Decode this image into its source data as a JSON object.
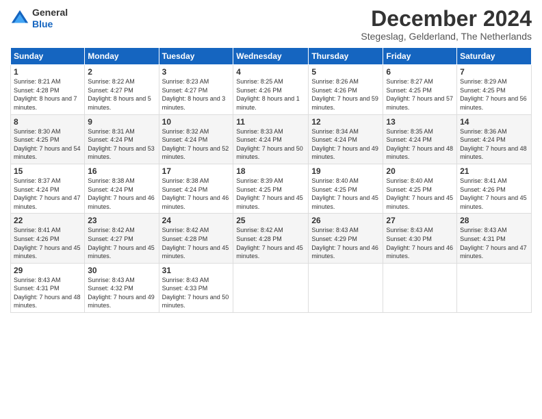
{
  "logo": {
    "general": "General",
    "blue": "Blue"
  },
  "header": {
    "month": "December 2024",
    "location": "Stegeslag, Gelderland, The Netherlands"
  },
  "weekdays": [
    "Sunday",
    "Monday",
    "Tuesday",
    "Wednesday",
    "Thursday",
    "Friday",
    "Saturday"
  ],
  "weeks": [
    [
      {
        "day": "1",
        "sunrise": "8:21 AM",
        "sunset": "4:28 PM",
        "daylight": "8 hours and 7 minutes."
      },
      {
        "day": "2",
        "sunrise": "8:22 AM",
        "sunset": "4:27 PM",
        "daylight": "8 hours and 5 minutes."
      },
      {
        "day": "3",
        "sunrise": "8:23 AM",
        "sunset": "4:27 PM",
        "daylight": "8 hours and 3 minutes."
      },
      {
        "day": "4",
        "sunrise": "8:25 AM",
        "sunset": "4:26 PM",
        "daylight": "8 hours and 1 minute."
      },
      {
        "day": "5",
        "sunrise": "8:26 AM",
        "sunset": "4:26 PM",
        "daylight": "7 hours and 59 minutes."
      },
      {
        "day": "6",
        "sunrise": "8:27 AM",
        "sunset": "4:25 PM",
        "daylight": "7 hours and 57 minutes."
      },
      {
        "day": "7",
        "sunrise": "8:29 AM",
        "sunset": "4:25 PM",
        "daylight": "7 hours and 56 minutes."
      }
    ],
    [
      {
        "day": "8",
        "sunrise": "8:30 AM",
        "sunset": "4:25 PM",
        "daylight": "7 hours and 54 minutes."
      },
      {
        "day": "9",
        "sunrise": "8:31 AM",
        "sunset": "4:24 PM",
        "daylight": "7 hours and 53 minutes."
      },
      {
        "day": "10",
        "sunrise": "8:32 AM",
        "sunset": "4:24 PM",
        "daylight": "7 hours and 52 minutes."
      },
      {
        "day": "11",
        "sunrise": "8:33 AM",
        "sunset": "4:24 PM",
        "daylight": "7 hours and 50 minutes."
      },
      {
        "day": "12",
        "sunrise": "8:34 AM",
        "sunset": "4:24 PM",
        "daylight": "7 hours and 49 minutes."
      },
      {
        "day": "13",
        "sunrise": "8:35 AM",
        "sunset": "4:24 PM",
        "daylight": "7 hours and 48 minutes."
      },
      {
        "day": "14",
        "sunrise": "8:36 AM",
        "sunset": "4:24 PM",
        "daylight": "7 hours and 48 minutes."
      }
    ],
    [
      {
        "day": "15",
        "sunrise": "8:37 AM",
        "sunset": "4:24 PM",
        "daylight": "7 hours and 47 minutes."
      },
      {
        "day": "16",
        "sunrise": "8:38 AM",
        "sunset": "4:24 PM",
        "daylight": "7 hours and 46 minutes."
      },
      {
        "day": "17",
        "sunrise": "8:38 AM",
        "sunset": "4:24 PM",
        "daylight": "7 hours and 46 minutes."
      },
      {
        "day": "18",
        "sunrise": "8:39 AM",
        "sunset": "4:25 PM",
        "daylight": "7 hours and 45 minutes."
      },
      {
        "day": "19",
        "sunrise": "8:40 AM",
        "sunset": "4:25 PM",
        "daylight": "7 hours and 45 minutes."
      },
      {
        "day": "20",
        "sunrise": "8:40 AM",
        "sunset": "4:25 PM",
        "daylight": "7 hours and 45 minutes."
      },
      {
        "day": "21",
        "sunrise": "8:41 AM",
        "sunset": "4:26 PM",
        "daylight": "7 hours and 45 minutes."
      }
    ],
    [
      {
        "day": "22",
        "sunrise": "8:41 AM",
        "sunset": "4:26 PM",
        "daylight": "7 hours and 45 minutes."
      },
      {
        "day": "23",
        "sunrise": "8:42 AM",
        "sunset": "4:27 PM",
        "daylight": "7 hours and 45 minutes."
      },
      {
        "day": "24",
        "sunrise": "8:42 AM",
        "sunset": "4:28 PM",
        "daylight": "7 hours and 45 minutes."
      },
      {
        "day": "25",
        "sunrise": "8:42 AM",
        "sunset": "4:28 PM",
        "daylight": "7 hours and 45 minutes."
      },
      {
        "day": "26",
        "sunrise": "8:43 AM",
        "sunset": "4:29 PM",
        "daylight": "7 hours and 46 minutes."
      },
      {
        "day": "27",
        "sunrise": "8:43 AM",
        "sunset": "4:30 PM",
        "daylight": "7 hours and 46 minutes."
      },
      {
        "day": "28",
        "sunrise": "8:43 AM",
        "sunset": "4:31 PM",
        "daylight": "7 hours and 47 minutes."
      }
    ],
    [
      {
        "day": "29",
        "sunrise": "8:43 AM",
        "sunset": "4:31 PM",
        "daylight": "7 hours and 48 minutes."
      },
      {
        "day": "30",
        "sunrise": "8:43 AM",
        "sunset": "4:32 PM",
        "daylight": "7 hours and 49 minutes."
      },
      {
        "day": "31",
        "sunrise": "8:43 AM",
        "sunset": "4:33 PM",
        "daylight": "7 hours and 50 minutes."
      },
      null,
      null,
      null,
      null
    ]
  ]
}
